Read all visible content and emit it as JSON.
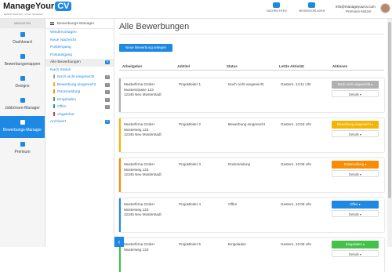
{
  "brand": {
    "name": "ManageYour",
    "badge": "CV",
    "tagline": "Einfach bewerben - immer organisiert"
  },
  "topnav": [
    {
      "label": "NACHRICHTEN",
      "icon": "chat-icon"
    },
    {
      "label": "WISSENVORLAGEN",
      "icon": "book-icon"
    }
  ],
  "user": {
    "email": "info@manageyourcv.com",
    "plan": "Premium-Nutzer"
  },
  "sidebar": {
    "heading": "NAVIGATION",
    "items": [
      {
        "label": "Dashboard",
        "icon": "user-icon"
      },
      {
        "label": "Bewerbungsmappen",
        "icon": "document-icon"
      },
      {
        "label": "Designs",
        "icon": "palette-icon"
      },
      {
        "label": "Jobbörsen-Manager",
        "icon": "briefcase-icon"
      },
      {
        "label": "Bewerbungs-Manager",
        "icon": "inbox-icon"
      },
      {
        "label": "Premium",
        "icon": "star-icon"
      }
    ]
  },
  "subnav": {
    "title": "Bewerbungs-Manager",
    "items": [
      {
        "label": "Wiedervorlagen",
        "type": "plain"
      },
      {
        "label": "Neue Nachricht",
        "type": "plain"
      },
      {
        "label": "Posteingang",
        "type": "plain"
      },
      {
        "label": "Postausgang",
        "type": "plain"
      },
      {
        "label": "Alle Bewerbungen",
        "type": "active",
        "count": "5"
      },
      {
        "label": "Nach Status",
        "type": "plain"
      },
      {
        "label": "Noch nicht eingereicht",
        "type": "sub",
        "count": "1",
        "color": "#9e9e9e"
      },
      {
        "label": "Bewerbung eingereicht",
        "type": "sub",
        "count": "1",
        "color": "#f5b400"
      },
      {
        "label": "Rückmeldung",
        "type": "sub",
        "count": "1",
        "color": "#fb8c00"
      },
      {
        "label": "Eingeladen",
        "type": "sub",
        "count": "1",
        "color": "#43a047"
      },
      {
        "label": "Offen",
        "type": "sub",
        "count": "1",
        "color": "#1e88e5"
      },
      {
        "label": "Abgelehnt",
        "type": "sub",
        "color": "#e53935"
      },
      {
        "label": "Archiviert",
        "type": "plain",
        "count": "0"
      }
    ]
  },
  "main": {
    "title": "Alle Bewerbungen",
    "new_button": "Neue Bewerbung anlegen",
    "columns": [
      "Arbeitgeber",
      "Jobtitel",
      "Status",
      "Letzte Aktivität",
      "Aktionen"
    ],
    "details_label": "Details ▾",
    "rows": [
      {
        "company": [
          "Musterfirma GmbH",
          "Musterstrasse 123",
          "12345 Neu Musterstadt"
        ],
        "job": "Projektleiter 1",
        "status": "Noch nicht eingereicht",
        "date": "Gestern, 14:11 Uhr",
        "action": "Noch nicht eingereicht ▾",
        "color": "#b0b0b0"
      },
      {
        "company": [
          "Musterfirma GmbH",
          "Musterweg 123",
          "12345 Neu Musterstadt"
        ],
        "job": "Projektleiter 2",
        "status": "Bewerbung eingereicht",
        "date": "Gestern, 10:53 Uhr",
        "action": "Bewerbung eingereicht ▾",
        "color": "#f5b400"
      },
      {
        "company": [
          "Musterfirma GmbH",
          "Musterweg 123",
          "12345 Neu Musterstadt"
        ],
        "job": "Projektleiter 3",
        "status": "Rückmeldung",
        "date": "Gestern, 10:09 Uhr",
        "action": "Rückmeldung ▾",
        "color": "#fb8c00"
      },
      {
        "company": [
          "Musterfirma GmbH",
          "Musterweg 123",
          "12345 Neu Musterstadt"
        ],
        "job": "Projektleiter 4",
        "status": "Offen",
        "date": "Gestern, 10:09 Uhr",
        "action": "Offen ▾",
        "color": "#1e88e5"
      },
      {
        "company": [
          "Musterfirma GmbH",
          "Musterweg 123"
        ],
        "job": "Projektleiter 5",
        "status": "Eingeladen",
        "date": "Gestern, 10:09 Uhr",
        "action": "Eingeladen ▾",
        "color": "#43c24a"
      }
    ]
  },
  "collapse_icon": "‹"
}
